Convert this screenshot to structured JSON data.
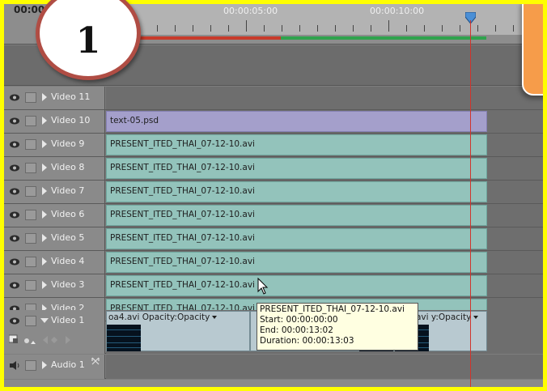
{
  "ruler": {
    "timecode_current": "00:00",
    "timecode_mid": "00:00:05:00",
    "timecode_right": "00:00:10:00"
  },
  "step_badge": {
    "number": "1"
  },
  "tracks": [
    {
      "name": "Video 11",
      "clip": ""
    },
    {
      "name": "Video 10",
      "clip": "text-05.psd"
    },
    {
      "name": "Video 9",
      "clip": "PRESENT_ITED_THAI_07-12-10.avi"
    },
    {
      "name": "Video 8",
      "clip": "PRESENT_ITED_THAI_07-12-10.avi"
    },
    {
      "name": "Video 7",
      "clip": "PRESENT_ITED_THAI_07-12-10.avi"
    },
    {
      "name": "Video 6",
      "clip": "PRESENT_ITED_THAI_07-12-10.avi"
    },
    {
      "name": "Video 5",
      "clip": "PRESENT_ITED_THAI_07-12-10.avi"
    },
    {
      "name": "Video 4",
      "clip": "PRESENT_ITED_THAI_07-12-10.avi"
    },
    {
      "name": "Video 3",
      "clip": "PRESENT_ITED_THAI_07-12-10.avi"
    },
    {
      "name": "Video 2",
      "clip": "PRESENT_ITED_THAI_07-12-10.avi"
    }
  ],
  "video1": {
    "name": "Video 1",
    "seg1_label": "oa4.avi",
    "seg1_opacity": "Opacity:Opacity",
    "seg2_label": "avi",
    "seg2_opacity": "y:Opacity"
  },
  "audio1": {
    "name": "Audio 1"
  },
  "tooltip": {
    "title": "PRESENT_ITED_THAI_07-12-10.avi",
    "start": "Start: 00:00:00:00",
    "end": "End: 00:00:13:02",
    "duration": "Duration: 00:00:13:03"
  },
  "colors": {
    "background_border": "#ffff00",
    "clip_avi": "#93c3bb",
    "clip_psd": "#a49fcb",
    "playhead": "#d0342c",
    "callout": "#f69c4a"
  }
}
